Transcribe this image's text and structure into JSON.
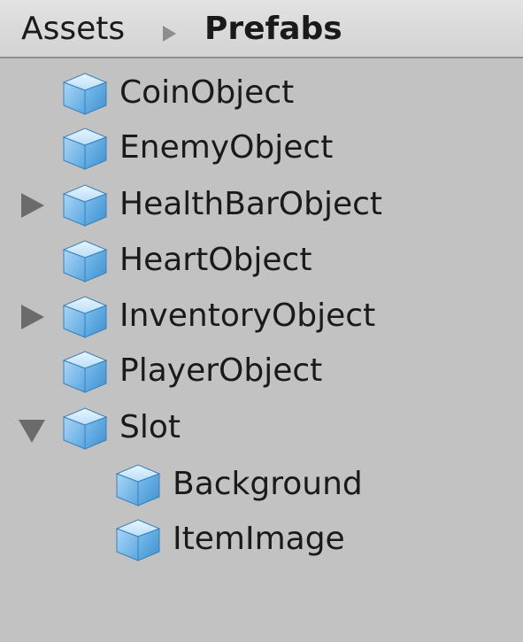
{
  "breadcrumb": {
    "root": "Assets",
    "current": "Prefabs",
    "separator_icon": "breadcrumb-arrow-icon"
  },
  "tree": {
    "items": [
      {
        "label": "CoinObject",
        "icon": "prefab-cube-icon",
        "foldout": "none",
        "depth": 0
      },
      {
        "label": "EnemyObject",
        "icon": "prefab-cube-icon",
        "foldout": "none",
        "depth": 0
      },
      {
        "label": "HealthBarObject",
        "icon": "prefab-cube-icon",
        "foldout": "collapsed",
        "depth": 0
      },
      {
        "label": "HeartObject",
        "icon": "prefab-cube-icon",
        "foldout": "none",
        "depth": 0
      },
      {
        "label": "InventoryObject",
        "icon": "prefab-cube-icon",
        "foldout": "collapsed",
        "depth": 0
      },
      {
        "label": "PlayerObject",
        "icon": "prefab-cube-icon",
        "foldout": "none",
        "depth": 0
      },
      {
        "label": "Slot",
        "icon": "prefab-cube-icon",
        "foldout": "expanded",
        "depth": 0
      },
      {
        "label": "Background",
        "icon": "prefab-cube-icon",
        "foldout": "none",
        "depth": 1
      },
      {
        "label": "ItemImage",
        "icon": "prefab-cube-icon",
        "foldout": "none",
        "depth": 1
      }
    ]
  },
  "colors": {
    "panel_background": "#c2c2c2",
    "header_background": "#dadada",
    "prefab_cube_top": "#cfe9fb",
    "prefab_cube_side": "#6fb4e8",
    "foldout_arrow": "#6b6b6b"
  }
}
